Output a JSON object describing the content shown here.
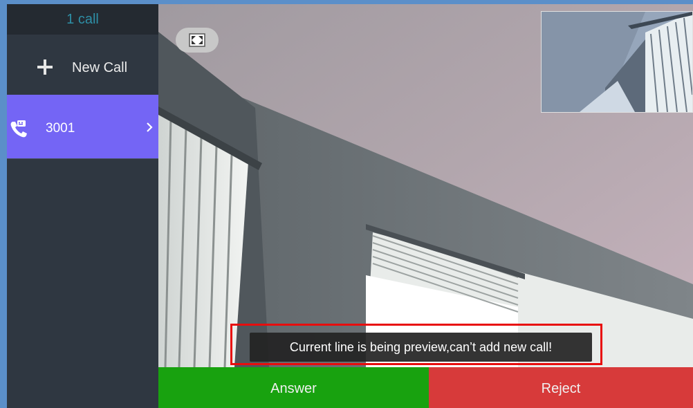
{
  "sidebar": {
    "header": "1 call",
    "new_call_label": "New Call",
    "active_call": {
      "number": "3001",
      "icon": "phone-video-icon"
    }
  },
  "video": {
    "fullscreen_icon": "fullscreen-icon"
  },
  "toast": {
    "message": "Current line is being preview,can’t add new call!",
    "highlight_color": "#e80d0d"
  },
  "actions": {
    "answer_label": "Answer",
    "reject_label": "Reject"
  },
  "colors": {
    "answer": "#18a20f",
    "reject": "#d73a3a",
    "active_call_bg": "#7465f5",
    "sidebar_bg": "#2f3741",
    "header_text": "#2e8fa6"
  }
}
